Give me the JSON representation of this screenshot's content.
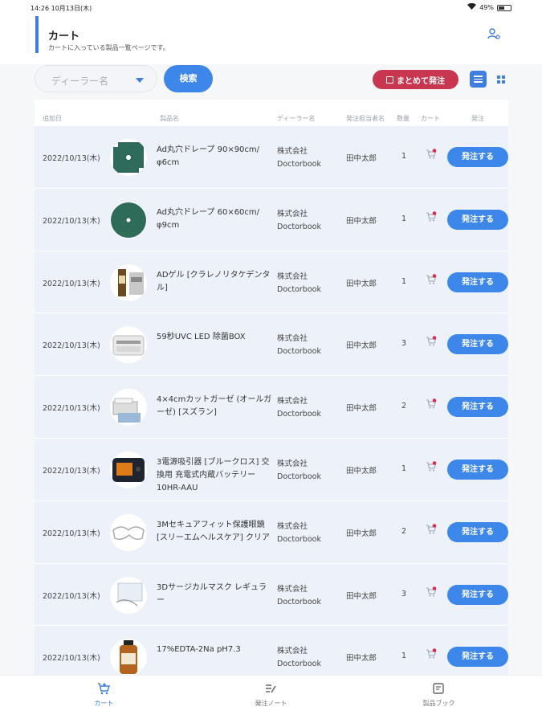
{
  "status_bar": {
    "time_date": "14:26   10月13日(木)",
    "battery": "49%"
  },
  "header": {
    "title": "カート",
    "subtitle": "カートに入っている製品一覧ページです。"
  },
  "toolbar": {
    "dealer_placeholder": "ディーラー名",
    "search_label": "検索",
    "bulk_order_label": "まとめて発注"
  },
  "table": {
    "columns": [
      "追加日",
      "製品名",
      "ディーラー名",
      "発注担当者名",
      "数量",
      "カート",
      "発注"
    ],
    "rows": [
      {
        "date": "2022/10/13(木)",
        "name": "Ad丸穴ドレープ 90×90cm/φ6cm",
        "dealer1": "株式会社",
        "dealer2": "Doctorbook",
        "person": "田中太郎",
        "qty": "1",
        "btn": "発注する"
      },
      {
        "date": "2022/10/13(木)",
        "name": "Ad丸穴ドレープ 60×60cm/φ9cm",
        "dealer1": "株式会社",
        "dealer2": "Doctorbook",
        "person": "田中太郎",
        "qty": "1",
        "btn": "発注する"
      },
      {
        "date": "2022/10/13(木)",
        "name": "ADゲル [クラレノリタケデンタル]",
        "dealer1": "株式会社",
        "dealer2": "Doctorbook",
        "person": "田中太郎",
        "qty": "1",
        "btn": "発注する"
      },
      {
        "date": "2022/10/13(木)",
        "name": "59秒UVC LED 除菌BOX",
        "dealer1": "株式会社",
        "dealer2": "Doctorbook",
        "person": "田中太郎",
        "qty": "3",
        "btn": "発注する"
      },
      {
        "date": "2022/10/13(木)",
        "name": "4×4cmカットガーゼ (オールガーゼ) [スズラン]",
        "dealer1": "株式会社",
        "dealer2": "Doctorbook",
        "person": "田中太郎",
        "qty": "2",
        "btn": "発注する"
      },
      {
        "date": "2022/10/13(木)",
        "name": "3電源吸引器 [ブルークロス] 交換用 充電式内蔵バッテリー10HR-AAU",
        "dealer1": "株式会社",
        "dealer2": "Doctorbook",
        "person": "田中太郎",
        "qty": "1",
        "btn": "発注する"
      },
      {
        "date": "2022/10/13(木)",
        "name": "3Mセキュアフィット保護眼鏡 [スリーエムヘルスケア] クリア",
        "dealer1": "株式会社",
        "dealer2": "Doctorbook",
        "person": "田中太郎",
        "qty": "2",
        "btn": "発注する"
      },
      {
        "date": "2022/10/13(木)",
        "name": "3Dサージカルマスク レギュラー",
        "dealer1": "株式会社",
        "dealer2": "Doctorbook",
        "person": "田中太郎",
        "qty": "3",
        "btn": "発注する"
      },
      {
        "date": "2022/10/13(木)",
        "name": "17%EDTA-2Na pH7.3",
        "dealer1": "株式会社",
        "dealer2": "Doctorbook",
        "person": "田中太郎",
        "qty": "1",
        "btn": "発注する"
      }
    ]
  },
  "tabbar": {
    "tabs": [
      {
        "label": "カート",
        "icon": "cart-icon",
        "active": true
      },
      {
        "label": "発注ノート",
        "icon": "note-icon",
        "active": false
      },
      {
        "label": "製品ブック",
        "icon": "book-icon",
        "active": false
      }
    ]
  },
  "colors": {
    "accent": "#3d86ea",
    "danger": "#c8364f",
    "row_bg": "#edf2fa"
  }
}
